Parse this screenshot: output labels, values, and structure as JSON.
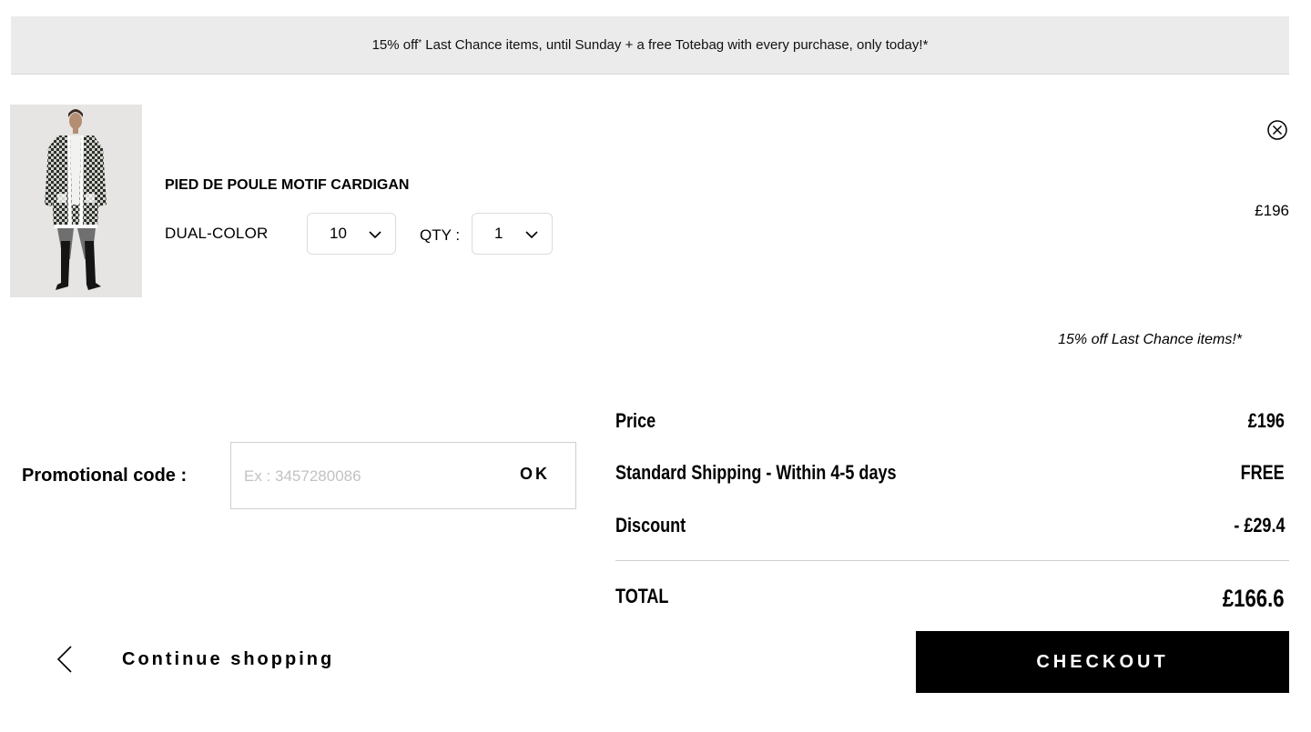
{
  "banner": {
    "prefix": "15% off",
    "superscript": "*",
    "suffix": " Last Chance items, until Sunday + a free Totebag with every purchase, only today!*"
  },
  "product": {
    "name": "PIED DE POULE MOTIF CARDIGAN",
    "color": "DUAL-COLOR",
    "size_value": "10",
    "qty_label": "QTY :",
    "qty_value": "1",
    "price": "£196",
    "promo_note": "15% off Last Chance items!*"
  },
  "promo": {
    "label": "Promotional code :",
    "placeholder": "Ex : 3457280086",
    "button_label": "OK"
  },
  "summary": {
    "price_label": "Price",
    "price_value": "£196",
    "shipping_label": "Standard Shipping - Within 4-5 days",
    "shipping_value": "FREE",
    "discount_label": "Discount",
    "discount_value": "- £29.4",
    "total_label": "TOTAL",
    "total_value": "£166.6"
  },
  "actions": {
    "continue_label": "Continue shopping",
    "checkout_label": "CHECKOUT"
  },
  "icons": {
    "remove": "close-circle-icon",
    "chevron": "chevron-down-icon",
    "back": "chevron-left-icon"
  }
}
